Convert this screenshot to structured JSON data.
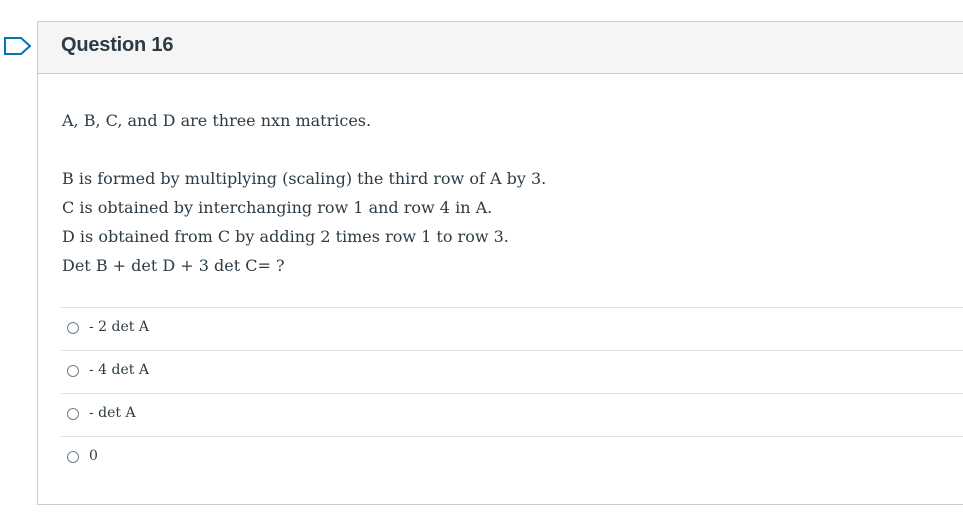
{
  "question": {
    "title": "Question 16",
    "intro": "A, B, C, and D are three nxn matrices.",
    "lines": [
      "B is formed by multiplying (scaling) the third row of A by 3.",
      "C is obtained by interchanging row 1 and row 4 in A.",
      "D is obtained from C by adding 2 times row 1 to row 3.",
      "Det B + det D + 3 det C= ?"
    ],
    "answers": [
      "- 2 det A",
      "- 4 det A",
      "- det A",
      "0"
    ]
  },
  "icons": {
    "flag": "flag-outline-icon",
    "radio": "radio-unchecked-icon"
  },
  "colors": {
    "flag_stroke": "#0374b5",
    "header_bg": "#f5f5f5",
    "border": "#c7cdd1",
    "text": "#2d3b45"
  }
}
